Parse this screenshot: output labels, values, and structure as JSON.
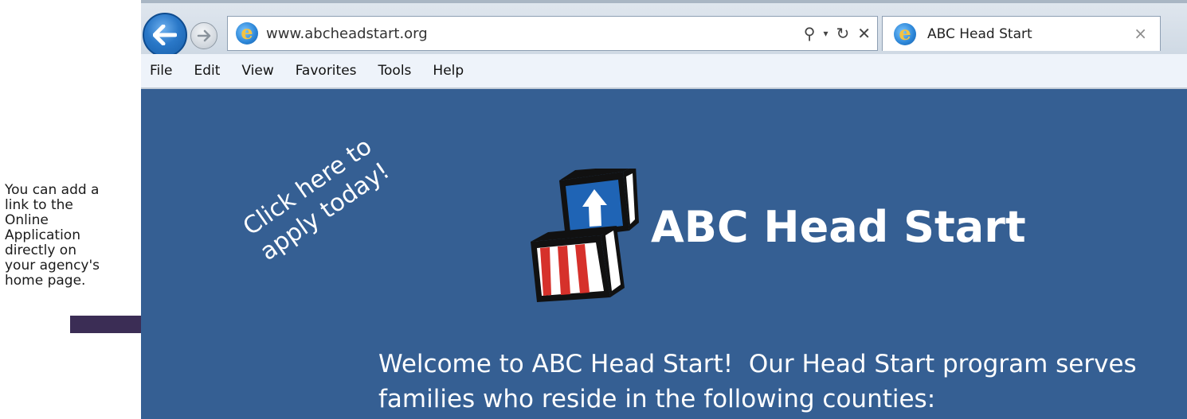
{
  "annotation": {
    "text_lines": [
      "You can add a",
      "link to the",
      "Online",
      "Application",
      "directly on",
      "your agency's",
      "home page."
    ]
  },
  "browser": {
    "url": "www.abcheadstart.org",
    "tab_title": "ABC Head Start",
    "menu": [
      "File",
      "Edit",
      "View",
      "Favorites",
      "Tools",
      "Help"
    ]
  },
  "page": {
    "promo_line1": "Click here to",
    "promo_line2": "apply today!",
    "site_title": "ABC Head Start",
    "welcome_line1": "Welcome to ABC Head Start!  Our Head Start program serves",
    "welcome_line2": "families who reside in the following counties:"
  },
  "colors": {
    "page_background": "#355f93",
    "arrow": "#3b2d55",
    "block_blue": "#1f64b5",
    "block_red": "#d6312b"
  }
}
